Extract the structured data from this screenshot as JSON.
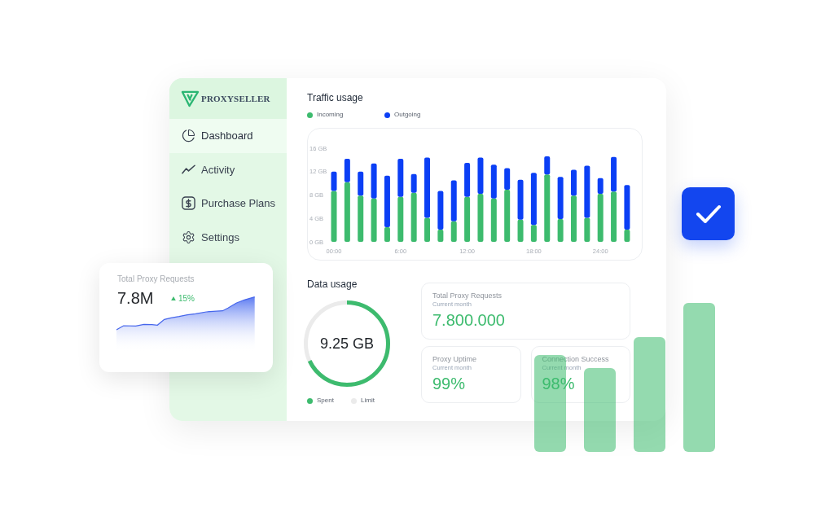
{
  "logo": {
    "text": "PROXYSELLER"
  },
  "sidebar": {
    "items": [
      {
        "label": "Dashboard",
        "selected": true
      },
      {
        "label": "Activity",
        "selected": false
      },
      {
        "label": "Purchase Plans",
        "selected": false
      },
      {
        "label": "Settings",
        "selected": false
      }
    ]
  },
  "traffic_usage": {
    "title": "Traffic usage",
    "chart_data": {
      "type": "bar",
      "stacked": true,
      "categories": [
        "00:00",
        null,
        null,
        null,
        null,
        "6:00",
        null,
        null,
        null,
        null,
        "12:00",
        null,
        null,
        null,
        null,
        "18:00",
        null,
        null,
        null,
        null,
        "24:00",
        null,
        null
      ],
      "ylim": [
        0,
        16
      ],
      "yticks": [
        {
          "value": 0,
          "label": "0 GB"
        },
        {
          "value": 4,
          "label": "4 GB"
        },
        {
          "value": 8,
          "label": "8 GB"
        },
        {
          "value": 12,
          "label": "12 GB"
        },
        {
          "value": 16,
          "label": "16 GB"
        }
      ],
      "series": [
        {
          "name": "Incoming",
          "color": "#3dbb6e",
          "values": [
            8.7,
            10.2,
            7.9,
            7.4,
            2.5,
            7.7,
            8.4,
            4.1,
            2.1,
            3.5,
            7.7,
            8.2,
            7.4,
            8.9,
            3.8,
            2.9,
            11.5,
            3.9,
            7.9,
            4.1,
            8.2,
            8.6,
            2.1
          ]
        },
        {
          "name": "Outgoing",
          "color": "#0b3ff5",
          "values": [
            3.3,
            4.0,
            4.1,
            6.0,
            8.8,
            6.5,
            3.2,
            10.3,
            6.6,
            7.0,
            5.8,
            6.2,
            5.8,
            3.7,
            6.8,
            8.9,
            3.1,
            7.2,
            4.4,
            8.9,
            2.7,
            5.9,
            7.6
          ]
        }
      ]
    }
  },
  "data_usage": {
    "title": "Data usage",
    "value": "9.25 GB",
    "level": 0.68,
    "legend": [
      {
        "label": "Spent",
        "color": "#3dbb6e"
      },
      {
        "label": "Limit",
        "color": "#ebebeb"
      }
    ]
  },
  "stats": [
    {
      "title": "Total Proxy Requests",
      "subtitle": "Current month",
      "value": "7.800.000"
    },
    {
      "title": "Proxy Uptime",
      "subtitle": "Current month",
      "value": "99%"
    },
    {
      "title": "Connection Success",
      "subtitle": "Current month",
      "value": "98%"
    }
  ],
  "floating_card": {
    "title": "Total Proxy Requests",
    "value": "7.8M",
    "change": "15%"
  },
  "confirm_tile": {
    "checked": true
  }
}
